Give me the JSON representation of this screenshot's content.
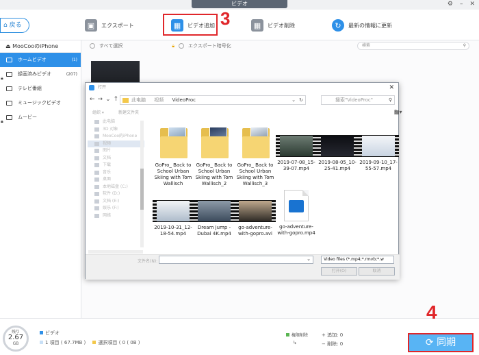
{
  "window": {
    "title": "ビデオ"
  },
  "toolbar": {
    "back_label": "戻る",
    "export_label": "エクスポート",
    "add_video_label": "ビデオ追加",
    "delete_video_label": "ビデオ削除",
    "refresh_label": "最新の情報に更新"
  },
  "steps": {
    "step3": "3",
    "step4": "4"
  },
  "sidebar": {
    "device": "MooCooのiPhone",
    "items": [
      {
        "label": "ホームビデオ",
        "count": "(1)"
      },
      {
        "label": "録画済みビデオ",
        "count": "(207)"
      },
      {
        "label": "テレビ番組",
        "count": ""
      },
      {
        "label": "ミュージックビデオ",
        "count": ""
      },
      {
        "label": "ムービー",
        "count": ""
      }
    ]
  },
  "content": {
    "select_all": "すべて選択",
    "export_encrypt": "エクスポート暗号化",
    "search_placeholder": "検索"
  },
  "dialog": {
    "title": "打开",
    "address": [
      "此电脑",
      "视频",
      "VideoProc"
    ],
    "search_placeholder": "搜索\"VideoProc\"",
    "organize": "组织 ▾",
    "new_folder": "新建文件夹",
    "tree": [
      "此电脑",
      "3D 对象",
      "MooCoo的iPhone",
      "视频",
      "图片",
      "文档",
      "下载",
      "音乐",
      "桌面",
      "本地磁盘 (C:)",
      "软件 (D:)",
      "文档 (E:)",
      "娱乐 (F:)",
      "网络"
    ],
    "files": [
      {
        "name": "GoPro_ Back to School Urban Skiing with Tom Wallisch",
        "kind": "folder"
      },
      {
        "name": "GoPro_ Back to School Urban Skiing with Tom Wallisch_2",
        "kind": "folder"
      },
      {
        "name": "GoPro_ Back to School Urban Skiing with Tom Wallisch_3",
        "kind": "folder"
      },
      {
        "name": "2019-07-08_15-39-07.mp4",
        "kind": "video"
      },
      {
        "name": "2019-08-05_10-25-41.mp4",
        "kind": "video"
      },
      {
        "name": "2019-09-10_17-55-57.mp4",
        "kind": "video"
      },
      {
        "name": "2019-10-31_12-18-54.mp4",
        "kind": "video"
      },
      {
        "name": "Dream Jump - Dubai 4K.mp4",
        "kind": "video"
      },
      {
        "name": "go-adventure-with-gopro.avi",
        "kind": "video"
      },
      {
        "name": "go-adventure-with-gopro.mp4",
        "kind": "doc"
      }
    ],
    "filename_label": "文件名(N):",
    "filename_value": "",
    "filetype": "Video files (*.mp4;*.rmvb;*.w",
    "open_btn": "打开(O)",
    "cancel_btn": "取消"
  },
  "bottom": {
    "storage_top": "残り",
    "storage_value": "2.67",
    "storage_unit": "GB",
    "category": "ビデオ",
    "items_info": "1 項目 ( 67.7MB )",
    "selected_info": "選択項目 ( 0 ( 0B )",
    "pending_label": "権限削除",
    "add_label": "追加:",
    "add_count": "0",
    "delete_label": "削除:",
    "delete_count": "0",
    "sync_label": "同期"
  },
  "colors": {
    "accent": "#2e90e8",
    "highlight": "#e0262a",
    "sync": "#58b4f4"
  }
}
